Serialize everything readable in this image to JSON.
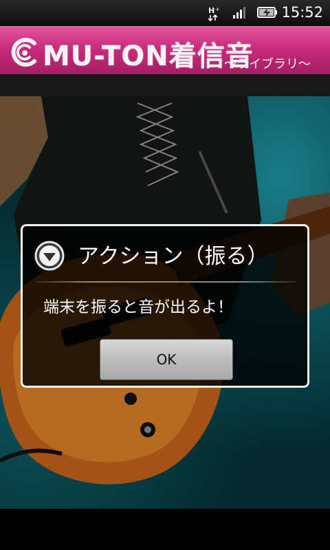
{
  "status_bar": {
    "network_icon": "hspa-plus-icon",
    "signal_icon": "signal-strength-icon",
    "battery_icon": "battery-charging-icon",
    "time": "15:52"
  },
  "app_header": {
    "logo_icon": "music-note-c-icon",
    "title": "MU-TON着信音",
    "subtitle": "～ライブラリ～",
    "colors": {
      "header_pink": "#c82a7c",
      "header_light": "#e2559c"
    }
  },
  "background": {
    "image": "guitarist-photo",
    "accent": "#0d5d66"
  },
  "dialog": {
    "icon": "down-arrow-circle-icon",
    "title": "アクション（振る）",
    "message": "端末を振ると音が出るよ！",
    "ok_label": "OK"
  }
}
